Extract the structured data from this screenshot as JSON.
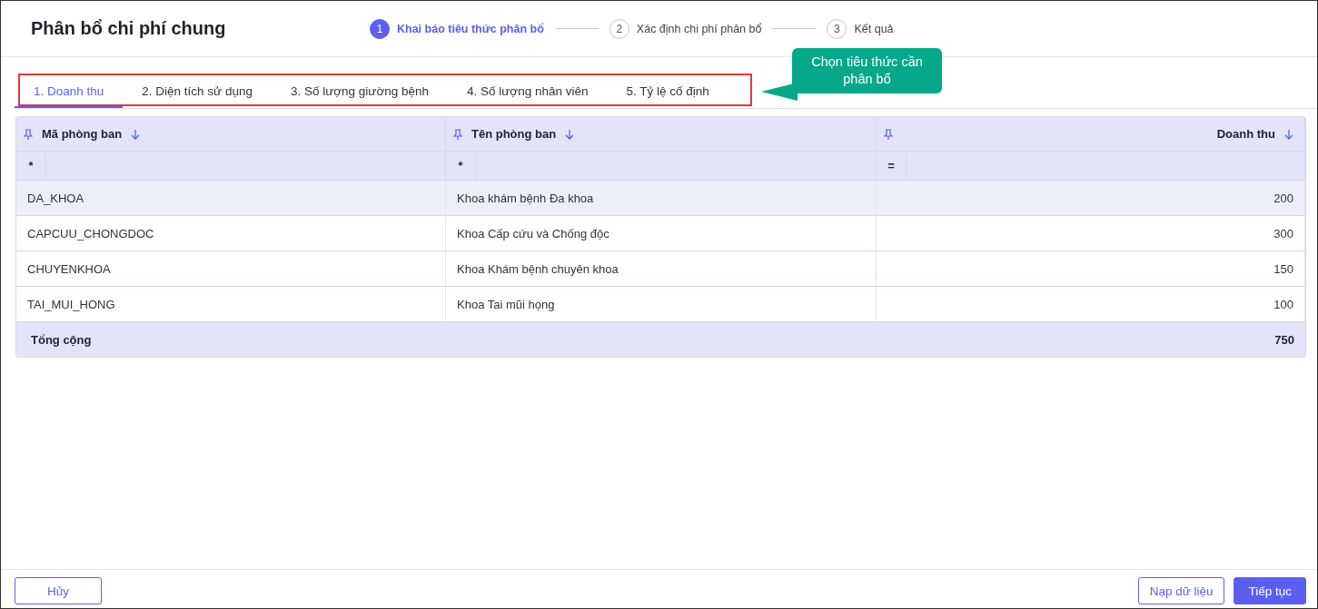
{
  "title": "Phân bổ chi phí chung",
  "steps": [
    {
      "number": "1",
      "label": "Khai báo tiêu thức phân bổ",
      "selected": true
    },
    {
      "number": "2",
      "label": "Xác định chi phí phân bổ",
      "selected": false
    },
    {
      "number": "3",
      "label": "Kết quả",
      "selected": false
    }
  ],
  "tabs": [
    {
      "label": "1. Doanh thu",
      "selected": true
    },
    {
      "label": "2. Diện tích sử dụng",
      "selected": false
    },
    {
      "label": "3. Số lượng giường bệnh",
      "selected": false
    },
    {
      "label": "4. Số lượng nhân viên",
      "selected": false
    },
    {
      "label": "5. Tỷ lệ cố định",
      "selected": false
    }
  ],
  "callout": {
    "text": "Chọn tiêu thức cần phân bổ"
  },
  "table": {
    "columns": [
      {
        "label": "Mã phòng ban",
        "filter": "*"
      },
      {
        "label": "Tên phòng ban",
        "filter": "*"
      },
      {
        "label": "Doanh thu",
        "filter": "="
      }
    ],
    "rows": [
      {
        "cells": [
          "DA_KHOA",
          "Khoa khám bệnh Đa khoa",
          "200"
        ],
        "selected": true
      },
      {
        "cells": [
          "CAPCUU_CHONGDOC",
          "Khoa Cấp cứu và Chống độc",
          "300"
        ],
        "selected": false
      },
      {
        "cells": [
          "CHUYENKHOA",
          "Khoa Khám bệnh chuyên khoa",
          "150"
        ],
        "selected": false
      },
      {
        "cells": [
          "TAI_MUI_HONG",
          "Khoa Tai mũi họng",
          "100"
        ],
        "selected": false
      }
    ],
    "total": {
      "label": "Tổng cộng",
      "value": "750"
    }
  },
  "buttons": {
    "cancel": "Hủy",
    "load": "Nạp dữ liệu",
    "next": "Tiếp tục"
  }
}
